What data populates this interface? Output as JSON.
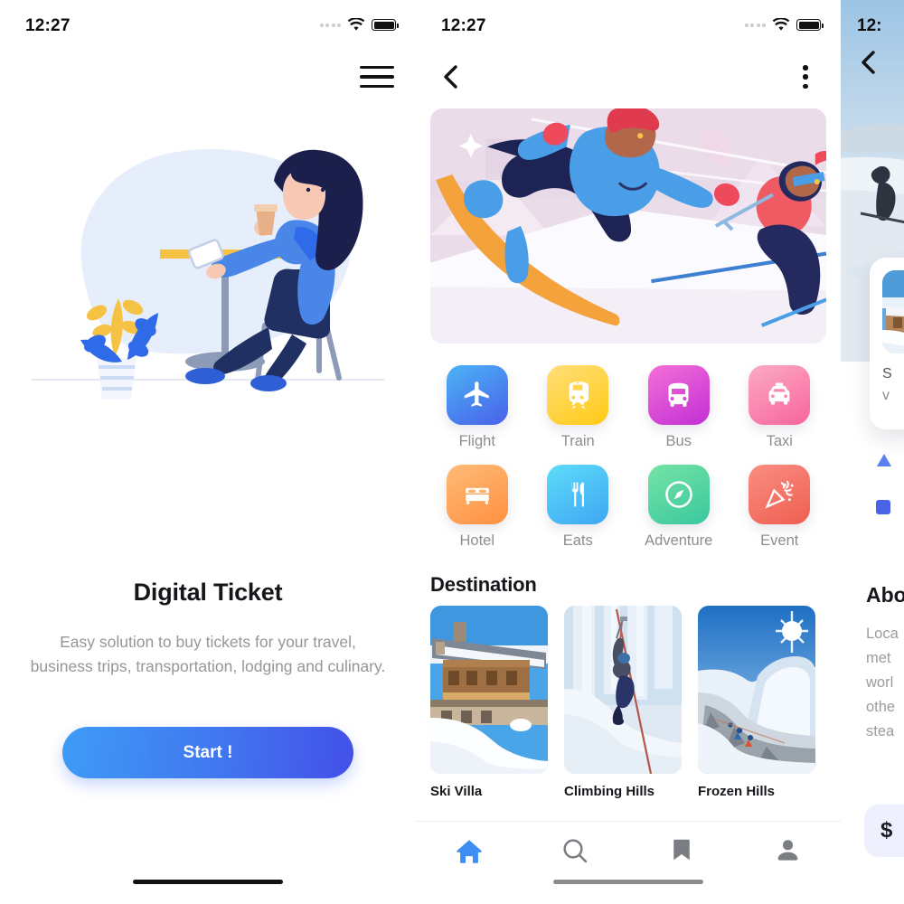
{
  "app": {
    "status_bar": {
      "time": "12:27",
      "wifi_icon": "wifi-icon",
      "battery_icon": "battery-full-icon",
      "signal_icon": "signal-dots-icon"
    }
  },
  "screens": {
    "onboarding": {
      "menu_icon": "hamburger-menu-icon",
      "illustration_name": "woman-at-cafe-table-illustration",
      "title": "Digital Ticket",
      "subtitle": "Easy solution to buy tickets for your travel, business trips, transportation, lodging and culinary.",
      "start_label": "Start !",
      "button_gradient_from": "#3e9bf7",
      "button_gradient_to": "#4350e8"
    },
    "home": {
      "back_icon": "chevron-left-icon",
      "more_icon": "kebab-menu-icon",
      "hero_name": "skier-snowboarder-illustration",
      "categories": [
        {
          "label": "Flight",
          "icon": "airplane-icon",
          "from": "#4ab4f5",
          "to": "#4a60ea"
        },
        {
          "label": "Train",
          "icon": "train-icon",
          "from": "#ffd86b",
          "to": "#ffcc20"
        },
        {
          "label": "Bus",
          "icon": "bus-icon",
          "from": "#f46fd6",
          "to": "#c938d8"
        },
        {
          "label": "Taxi",
          "icon": "taxi-icon",
          "from": "#f9a8c0",
          "to": "#f9679f"
        },
        {
          "label": "Hotel",
          "icon": "bed-icon",
          "from": "#ffb36b",
          "to": "#ff9248"
        },
        {
          "label": "Eats",
          "icon": "fork-knife-icon",
          "from": "#57d6f7",
          "to": "#44a9f2"
        },
        {
          "label": "Adventure",
          "icon": "compass-icon",
          "from": "#6ee0a2",
          "to": "#3fc9a0"
        },
        {
          "label": "Event",
          "icon": "party-popper-icon",
          "from": "#f8847c",
          "to": "#ef6354"
        }
      ],
      "section_title": "Destination",
      "destinations": [
        {
          "name": "Ski Villa",
          "image": "wooden-chalet-in-snow-photo"
        },
        {
          "name": "Climbing Hills",
          "image": "ice-climber-photo"
        },
        {
          "name": "Frozen Hills",
          "image": "sunlit-snowy-mountain-photo"
        }
      ],
      "tabs": [
        {
          "name": "home",
          "icon": "home-icon",
          "active": true,
          "color": "#3d8ef5"
        },
        {
          "name": "search",
          "icon": "search-icon",
          "active": false,
          "color": "#7a7d82"
        },
        {
          "name": "saved",
          "icon": "bookmark-icon",
          "active": false,
          "color": "#7a7d82"
        },
        {
          "name": "profile",
          "icon": "person-icon",
          "active": false,
          "color": "#7a7d82"
        }
      ]
    },
    "detail": {
      "time": "12:",
      "back_icon": "chevron-left-icon",
      "hero_name": "cross-country-skiers-photo",
      "card": {
        "thumb": "snow-village-thumb-photo",
        "line1": "S",
        "line2": "v"
      },
      "about_title": "Abo",
      "about_body": "Loca\nmet\nworl\nothe\nstea",
      "cta_label": "$"
    }
  }
}
